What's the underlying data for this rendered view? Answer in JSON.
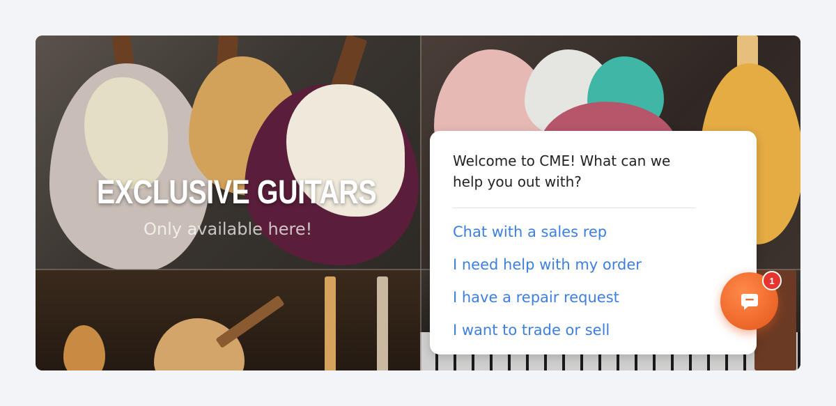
{
  "hero": {
    "title": "EXCLUSIVE GUITARS",
    "subtitle": "Only available here!"
  },
  "chat_widget": {
    "welcome": "Welcome to CME! What can we help you out with?",
    "options": [
      {
        "label": "Chat with a sales rep"
      },
      {
        "label": "I need help with my order"
      },
      {
        "label": "I have a repair request"
      },
      {
        "label": "I want to trade or sell"
      }
    ],
    "launcher_icon": "chat-bubble-icon",
    "unread_count": "1"
  },
  "colors": {
    "link": "#3d7fe0",
    "launcher": "#ef6a2d",
    "badge": "#e8342f",
    "page_background": "#f3f4f7"
  }
}
